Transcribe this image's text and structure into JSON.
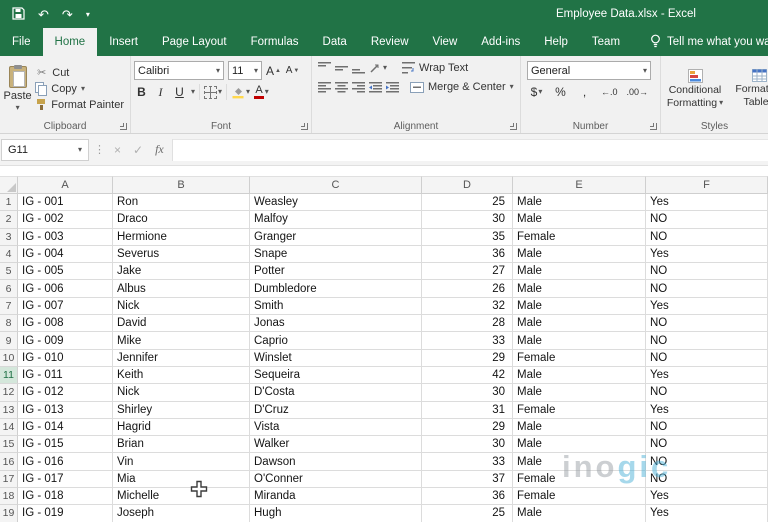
{
  "colors": {
    "excel_green": "#217346",
    "ribbon_bg": "#f1f1f1",
    "selected_row_header_bg": "#d4e7db",
    "gridline": "#dcdcdc",
    "watermark_gray": "#9aa0a6",
    "watermark_blue": "#4fb3d9",
    "font_color_swatch": "#c00000",
    "fill_color_swatch": "#ffd84d"
  },
  "titlebar": {
    "title": "Employee Data.xlsx  -  Excel"
  },
  "tabs": {
    "active": "Home",
    "items": [
      "File",
      "Home",
      "Insert",
      "Page Layout",
      "Formulas",
      "Data",
      "Review",
      "View",
      "Add-ins",
      "Help",
      "Team"
    ],
    "tell_me": "Tell me what you want to do"
  },
  "ribbon": {
    "clipboard": {
      "label": "Clipboard",
      "paste": "Paste",
      "cut": "Cut",
      "copy": "Copy",
      "format_painter": "Format Painter"
    },
    "font": {
      "label": "Font",
      "family": "Calibri",
      "size": "11",
      "bold": "B",
      "italic": "I",
      "underline": "U",
      "font_color_letter": "A"
    },
    "alignment": {
      "label": "Alignment",
      "wrap_text": "Wrap Text",
      "merge_center": "Merge & Center"
    },
    "number": {
      "label": "Number",
      "format": "General",
      "currency": "$",
      "percent": "%",
      "comma": ",",
      "increase_decimal": "←.0",
      "decrease_decimal": ".00→"
    },
    "styles": {
      "label": "Styles",
      "conditional_line1": "Conditional",
      "conditional_line2": "Formatting",
      "table_line1": "Format as",
      "table_line2": "Table"
    }
  },
  "formula_bar": {
    "name_box": "G11",
    "fx": "fx",
    "formula": ""
  },
  "sheet": {
    "columns": [
      "A",
      "B",
      "C",
      "D",
      "E",
      "F"
    ],
    "selected_row": 11,
    "rows": [
      [
        "IG - 001",
        "Ron",
        "Weasley",
        "25",
        "Male",
        "Yes"
      ],
      [
        "IG - 002",
        "Draco",
        "Malfoy",
        "30",
        "Male",
        "NO"
      ],
      [
        "IG - 003",
        "Hermione",
        "Granger",
        "35",
        "Female",
        "NO"
      ],
      [
        "IG - 004",
        "Severus",
        "Snape",
        "36",
        "Male",
        "Yes"
      ],
      [
        "IG - 005",
        "Jake",
        "Potter",
        "27",
        "Male",
        "NO"
      ],
      [
        "IG - 006",
        "Albus",
        "Dumbledore",
        "26",
        "Male",
        "NO"
      ],
      [
        "IG - 007",
        "Nick",
        "Smith",
        "32",
        "Male",
        "Yes"
      ],
      [
        "IG - 008",
        "David",
        "Jonas",
        "28",
        "Male",
        "NO"
      ],
      [
        "IG - 009",
        "Mike",
        "Caprio",
        "33",
        "Male",
        "NO"
      ],
      [
        "IG - 010",
        "Jennifer",
        "Winslet",
        "29",
        "Female",
        "NO"
      ],
      [
        "IG - 011",
        "Keith",
        "Sequeira",
        "42",
        "Male",
        "Yes"
      ],
      [
        "IG - 012",
        "Nick",
        "D'Costa",
        "30",
        "Male",
        "NO"
      ],
      [
        "IG - 013",
        "Shirley",
        "D'Cruz",
        "31",
        "Female",
        "Yes"
      ],
      [
        "IG - 014",
        "Hagrid",
        "Vista",
        "29",
        "Male",
        "NO"
      ],
      [
        "IG - 015",
        "Brian",
        "Walker",
        "30",
        "Male",
        "NO"
      ],
      [
        "IG - 016",
        "Vin",
        "Dawson",
        "33",
        "Male",
        "NO"
      ],
      [
        "IG - 017",
        "Mia",
        "O'Conner",
        "37",
        "Female",
        "NO"
      ],
      [
        "IG - 018",
        "Michelle",
        "Miranda",
        "36",
        "Female",
        "Yes"
      ],
      [
        "IG - 019",
        "Joseph",
        "Hugh",
        "25",
        "Male",
        "Yes"
      ]
    ]
  },
  "watermark": {
    "gray": "ino",
    "blue": "gic"
  }
}
